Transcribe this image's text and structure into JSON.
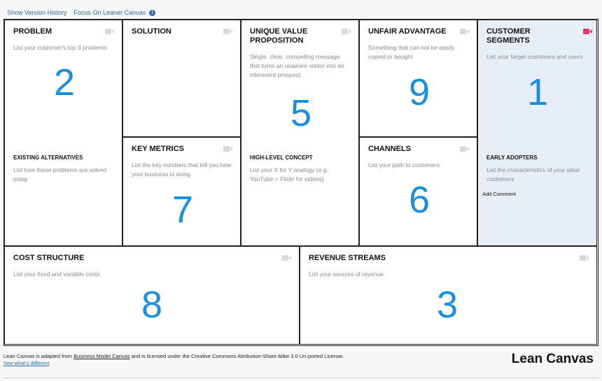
{
  "toplinks": {
    "version_history": "Show Version History",
    "focus": "Focus On Leaner Canvas",
    "info_glyph": "i"
  },
  "blocks": {
    "problem": {
      "title": "PROBLEM",
      "desc": "List your customer's top 3 problems",
      "number": "2",
      "sub_title": "EXISTING ALTERNATIVES",
      "sub_desc": "List how these problems are solved today"
    },
    "solution": {
      "title": "SOLUTION"
    },
    "key_metrics": {
      "title": "KEY METRICS",
      "desc": "List the key numbers that tell you how your business is doing",
      "number": "7"
    },
    "uvp": {
      "title": "UNIQUE VALUE PROPOSITION",
      "desc": "Single, clear, compelling message that turns an unaware visitor into an interested prospect",
      "number": "5",
      "sub_title": "HIGH-LEVEL CONCEPT",
      "sub_desc": "List your X for Y analogy (e.g. YouTube = Flickr for videos)"
    },
    "unfair_advantage": {
      "title": "UNFAIR ADVANTAGE",
      "desc": "Something that can not be easily copied or bought",
      "number": "9"
    },
    "channels": {
      "title": "CHANNELS",
      "desc": "List your path to customers",
      "number": "6"
    },
    "customer_segments": {
      "title": "CUSTOMER SEGMENTS",
      "desc": "List your target customers and users",
      "number": "1",
      "sub_title": "EARLY ADOPTERS",
      "sub_desc": "List the characteristics of your ideal customers",
      "add_comment": "Add Comment"
    },
    "cost_structure": {
      "title": "COST STRUCTURE",
      "desc": "List your fixed and variable costs",
      "number": "8"
    },
    "revenue_streams": {
      "title": "REVENUE STREAMS",
      "desc": "List your sources of revenue",
      "number": "3"
    }
  },
  "footer": {
    "text_before": "Lean Canvas is adapted from ",
    "bmc_link": "Business Model Canvas",
    "text_after": " and is licensed under the Creative Commons Attribution-Share Alike 3.0 Un-ported License. ",
    "diff_link": "See what's different",
    "brand": "Lean Canvas"
  },
  "colors": {
    "accent_number": "#1a8fe0",
    "link": "#2a6db5",
    "highlight_bg": "#e8eef8",
    "active_camera": "#e8336b"
  },
  "icons": {
    "camera": "video-camera-icon",
    "info": "info-icon"
  }
}
